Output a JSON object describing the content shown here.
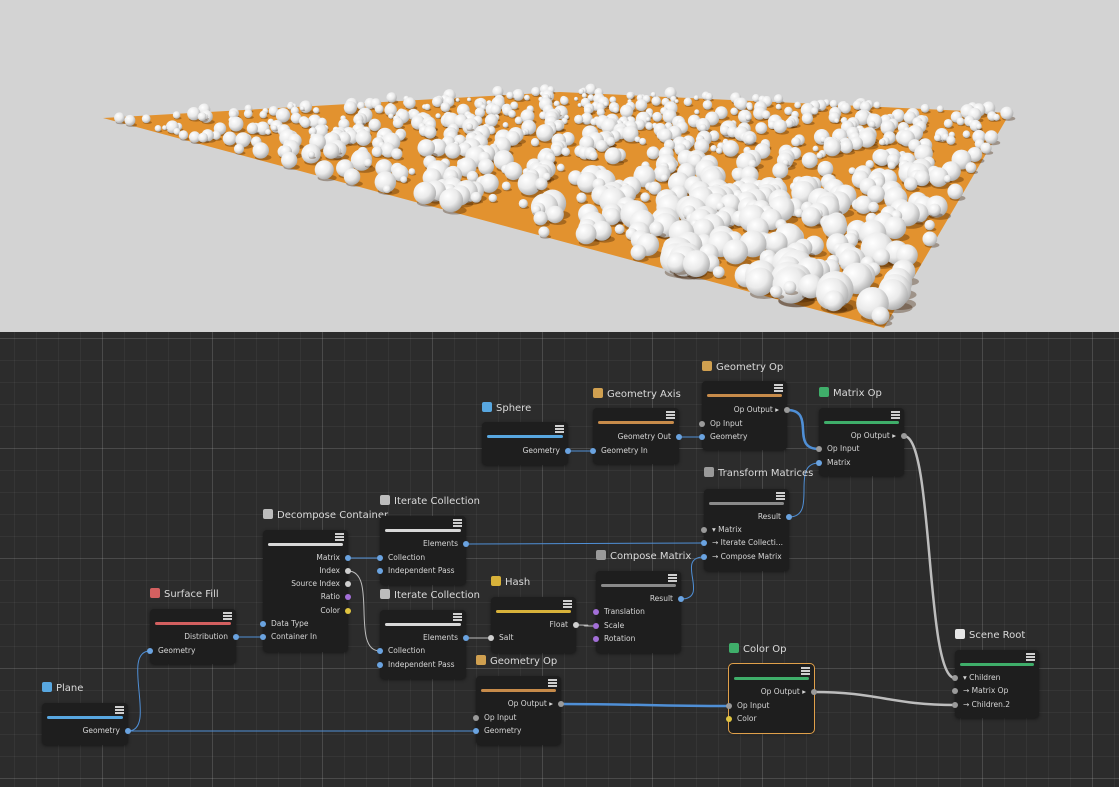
{
  "colors": {
    "viewport_bg": "#d3d3d3",
    "plane_color": "#e2922f",
    "sphere_color": "#f2f2f2",
    "graph_bg": "#2c2c2c",
    "wire_blue": "#4f8fd6",
    "wire_gray": "#bdbdbd",
    "selection": "#e0a04a"
  },
  "nodes": {
    "sphere": {
      "title": "Sphere",
      "icon": "sphere-icon",
      "bar": "#58a7e0",
      "ports": [
        {
          "label": "Geometry",
          "dir": "out"
        }
      ]
    },
    "geometry_axis": {
      "title": "Geometry Axis",
      "icon": "geometry-icon",
      "bar": "#c78b4a",
      "ports": [
        {
          "label": "Geometry Out",
          "dir": "out"
        },
        {
          "label": "Geometry In",
          "dir": "in"
        }
      ]
    },
    "geometry_op_top": {
      "title": "Geometry Op",
      "icon": "geometry-icon",
      "bar": "#c78b4a",
      "ports": [
        {
          "label": "Op Output ▸",
          "dir": "out"
        },
        {
          "label": "Op Input",
          "dir": "in"
        },
        {
          "label": "Geometry",
          "dir": "in"
        }
      ]
    },
    "matrix_op": {
      "title": "Matrix Op",
      "icon": "matrix-op-icon",
      "bar": "#3fae6a",
      "ports": [
        {
          "label": "Op Output ▸",
          "dir": "out"
        },
        {
          "label": "Op Input",
          "dir": "in"
        },
        {
          "label": "Matrix",
          "dir": "in"
        }
      ]
    },
    "transform_matrices": {
      "title": "Transform Matrices",
      "icon": "function-icon",
      "bar": "#8a8a8a",
      "ports": [
        {
          "label": "Result",
          "dir": "out"
        },
        {
          "label": "▾ Matrix",
          "dir": "in"
        },
        {
          "label": "→ Iterate Collecti...",
          "dir": "in"
        },
        {
          "label": "→ Compose Matrix",
          "dir": "in"
        }
      ]
    },
    "decompose_container": {
      "title": "Decompose Container",
      "icon": "decompose-icon",
      "bar": "#d8d8d8",
      "ports": [
        {
          "label": "Matrix",
          "dir": "out"
        },
        {
          "label": "Index",
          "dir": "out"
        },
        {
          "label": "Source Index",
          "dir": "out"
        },
        {
          "label": "Ratio",
          "dir": "out"
        },
        {
          "label": "Color",
          "dir": "out"
        },
        {
          "label": "Data Type",
          "dir": "in"
        },
        {
          "label": "Container In",
          "dir": "in"
        }
      ]
    },
    "iterate_collection_1": {
      "title": "Iterate Collection",
      "icon": "iterate-icon",
      "bar": "#d8d8d8",
      "ports": [
        {
          "label": "Elements",
          "dir": "out"
        },
        {
          "label": "Collection",
          "dir": "in"
        },
        {
          "label": "Independent Pass",
          "dir": "in"
        }
      ]
    },
    "iterate_collection_2": {
      "title": "Iterate Collection",
      "icon": "iterate-icon",
      "bar": "#d8d8d8",
      "ports": [
        {
          "label": "Elements",
          "dir": "out"
        },
        {
          "label": "Collection",
          "dir": "in"
        },
        {
          "label": "Independent Pass",
          "dir": "in"
        }
      ]
    },
    "hash": {
      "title": "Hash",
      "icon": "hash-icon",
      "bar": "#d8b23a",
      "ports": [
        {
          "label": "Float",
          "dir": "out"
        },
        {
          "label": "Salt",
          "dir": "in"
        }
      ]
    },
    "compose_matrix": {
      "title": "Compose Matrix",
      "icon": "function-icon",
      "bar": "#8a8a8a",
      "ports": [
        {
          "label": "Result",
          "dir": "out"
        },
        {
          "label": "Translation",
          "dir": "in"
        },
        {
          "label": "Scale",
          "dir": "in"
        },
        {
          "label": "Rotation",
          "dir": "in"
        }
      ]
    },
    "surface_fill": {
      "title": "Surface Fill",
      "icon": "surface-fill-icon",
      "bar": "#d36060",
      "ports": [
        {
          "label": "Distribution",
          "dir": "out"
        },
        {
          "label": "Geometry",
          "dir": "in"
        }
      ]
    },
    "plane": {
      "title": "Plane",
      "icon": "plane-icon",
      "bar": "#58a7e0",
      "ports": [
        {
          "label": "Geometry",
          "dir": "out"
        }
      ]
    },
    "geometry_op_bottom": {
      "title": "Geometry Op",
      "icon": "geometry-icon",
      "bar": "#c78b4a",
      "ports": [
        {
          "label": "Op Output ▸",
          "dir": "out"
        },
        {
          "label": "Op Input",
          "dir": "in"
        },
        {
          "label": "Geometry",
          "dir": "in"
        }
      ]
    },
    "color_op": {
      "title": "Color Op",
      "icon": "color-op-icon",
      "bar": "#3fae6a",
      "selected": true,
      "ports": [
        {
          "label": "Op Output ▸",
          "dir": "out"
        },
        {
          "label": "Op Input",
          "dir": "in"
        },
        {
          "label": "Color",
          "dir": "in"
        }
      ]
    },
    "scene_root": {
      "title": "Scene Root",
      "icon": "scene-root-icon",
      "bar": "#3fae6a",
      "ports": [
        {
          "label": "▾ Children",
          "dir": "in"
        },
        {
          "label": "→ Matrix Op",
          "dir": "in"
        },
        {
          "label": "→ Children.2",
          "dir": "in"
        }
      ]
    }
  }
}
